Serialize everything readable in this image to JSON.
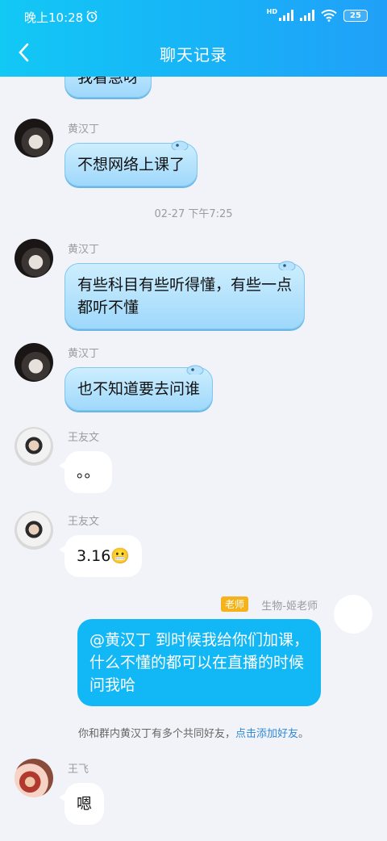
{
  "status_bar": {
    "time": "晚上10:28",
    "network": "HD",
    "battery": "25"
  },
  "nav": {
    "title": "聊天记录"
  },
  "messages": [
    {
      "sender": "",
      "text": "我看急呀"
    },
    {
      "sender": "黄汉丁",
      "text": "不想网络上课了"
    },
    {
      "timestamp": "02-27 下午7:25"
    },
    {
      "sender": "黄汉丁",
      "line1": "有些科目有些听得懂，有些一点",
      "line2": "都听不懂"
    },
    {
      "sender": "黄汉丁",
      "text": "也不知道要去问谁"
    },
    {
      "sender": "王友文",
      "text": "。。"
    },
    {
      "sender": "王友文",
      "text": "3.16😬"
    },
    {
      "badge": "老师",
      "sender": "生物-姬老师",
      "line1": "@黄汉丁 到时候我给你们加课，",
      "line2": "什么不懂的都可以在直播的时候",
      "line3": "问我哈"
    },
    {
      "notice": "你和群内黄汉丁有多个共同好友，",
      "link": "点击添加好友",
      "end": "。"
    },
    {
      "sender": "王飞",
      "text": "嗯"
    }
  ],
  "colors": {
    "header_start": "#12c8f5",
    "header_end": "#20a0f8",
    "my_bubble": "#12b7f5",
    "badge": "#f5b31b",
    "link": "#2e8ad8"
  }
}
